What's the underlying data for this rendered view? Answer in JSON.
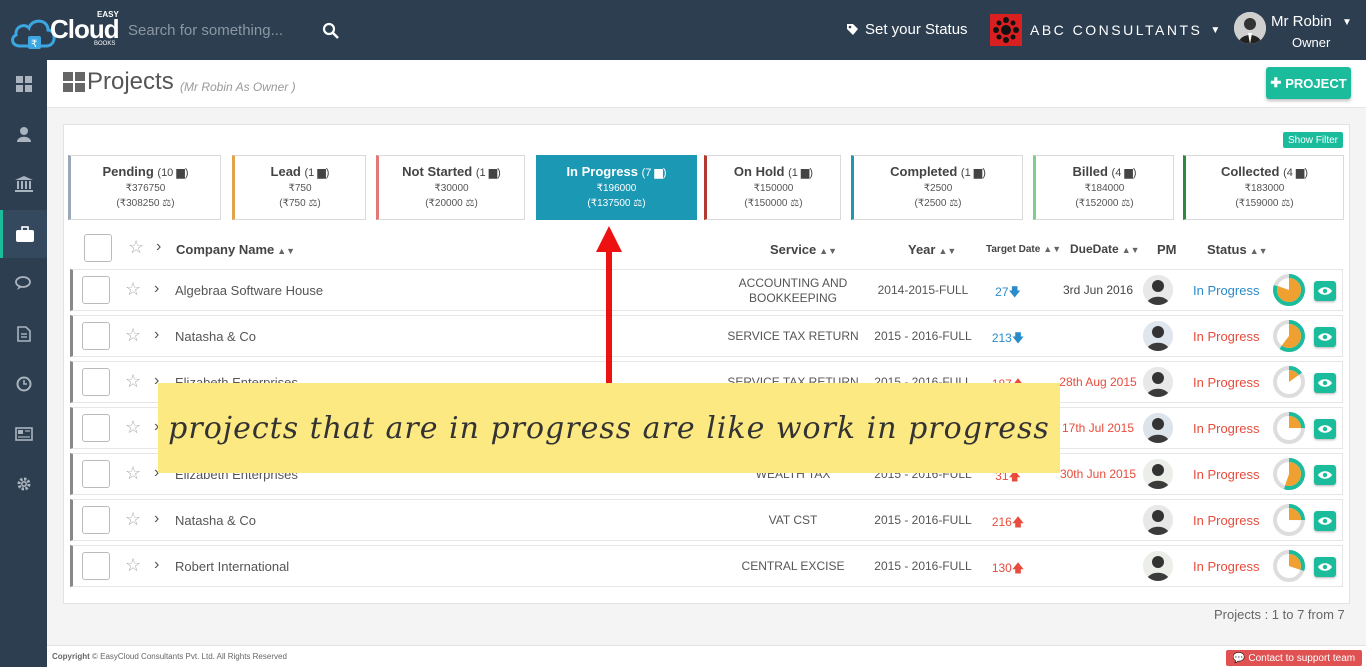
{
  "header": {
    "logo_easy": "EASY",
    "logo_cloud": "Cloud",
    "logo_books": "BOOKS",
    "search_placeholder": "Search for something...",
    "status_label": "Set your Status",
    "company_name": "ABC CONSULTANTS",
    "user_name": "Mr Robin",
    "user_role": "Owner"
  },
  "sidebar": {
    "items": [
      "dashboard-icon",
      "user-icon",
      "bank-icon",
      "briefcase-icon",
      "chat-icon",
      "document-icon",
      "clock-icon",
      "newspaper-icon",
      "gear-icon"
    ],
    "active": "briefcase-icon"
  },
  "page": {
    "title": "Projects",
    "subtitle": "(Mr Robin As Owner )",
    "add_button": "PROJECT",
    "show_filter": "Show Filter"
  },
  "status_tabs": [
    {
      "name": "Pending",
      "count": "(10",
      "amount": "₹376750",
      "sub": "(₹308250",
      "color": "#9aa7b4",
      "active": false
    },
    {
      "name": "Lead",
      "count": "(1",
      "amount": "₹750",
      "sub": "(₹750",
      "color": "#e0a54a",
      "active": false
    },
    {
      "name": "Not Started",
      "count": "(1",
      "amount": "₹30000",
      "sub": "(₹20000",
      "color": "#e07a7a",
      "active": false
    },
    {
      "name": "In Progress",
      "count": "(7",
      "amount": "₹196000",
      "sub": "(₹137500",
      "color": "#1b98b4",
      "active": true
    },
    {
      "name": "On Hold",
      "count": "(1",
      "amount": "₹150000",
      "sub": "(₹150000",
      "color": "#b03a2e",
      "active": false
    },
    {
      "name": "Completed",
      "count": "(1",
      "amount": "₹2500",
      "sub": "(₹2500",
      "color": "#1b98b4",
      "active": false
    },
    {
      "name": "Billed",
      "count": "(4",
      "amount": "₹184000",
      "sub": "(₹152000",
      "color": "#7bd08a",
      "active": false
    },
    {
      "name": "Collected",
      "count": "(4",
      "amount": "₹183000",
      "sub": "(₹159000",
      "color": "#2e8b3e",
      "active": false
    }
  ],
  "table": {
    "headers": {
      "company": "Company Name",
      "service": "Service",
      "year": "Year",
      "target": "Target Date",
      "due": "DueDate",
      "pm": "PM",
      "status": "Status"
    },
    "rows": [
      {
        "company": "Algebraa Software House",
        "service": "ACCOUNTING AND BOOKKEEPING",
        "year": "2014-2015-FULL",
        "target": "27",
        "target_dir": "down",
        "due": "3rd Jun 2016",
        "due_late": false,
        "status": "In Progress",
        "status_color": "blue",
        "progress": 0.8
      },
      {
        "company": "Natasha & Co",
        "service": "SERVICE TAX RETURN",
        "year": "2015 - 2016-FULL",
        "target": "213",
        "target_dir": "down",
        "due": "",
        "due_late": false,
        "status": "In Progress",
        "status_color": "red",
        "progress": 0.6
      },
      {
        "company": "Elizabeth Enterprises",
        "service": "SERVICE TAX RETURN",
        "year": "2015 - 2016-FULL",
        "target": "187",
        "target_dir": "up",
        "due": "28th Aug 2015",
        "due_late": true,
        "status": "In Progress",
        "status_color": "red",
        "progress": 0.15
      },
      {
        "company": "",
        "service": "",
        "year": "",
        "target": "",
        "target_dir": "up",
        "due": "17th Jul 2015",
        "due_late": true,
        "status": "In Progress",
        "status_color": "red",
        "progress": 0.25
      },
      {
        "company": "Elizabeth Enterprises",
        "service": "WEALTH TAX",
        "year": "2015 - 2016-FULL",
        "target": "31",
        "target_dir": "up",
        "due": "30th Jun 2015",
        "due_late": true,
        "status": "In Progress",
        "status_color": "red",
        "progress": 0.55
      },
      {
        "company": "Natasha & Co",
        "service": "VAT CST",
        "year": "2015 - 2016-FULL",
        "target": "216",
        "target_dir": "up",
        "due": "",
        "due_late": false,
        "status": "In Progress",
        "status_color": "red",
        "progress": 0.25
      },
      {
        "company": "Robert International",
        "service": "CENTRAL EXCISE",
        "year": "2015 - 2016-FULL",
        "target": "130",
        "target_dir": "up",
        "due": "",
        "due_late": false,
        "status": "In Progress",
        "status_color": "red",
        "progress": 0.3
      }
    ]
  },
  "paging": "Projects : 1 to 7 from 7",
  "footer": {
    "copyright_bold": "Copyright",
    "copyright": "© EasyCloud Consultants Pvt. Ltd. All Rights Reserved",
    "support": "Contact to support team"
  },
  "annotation": "projects that are in progress are like work in progress"
}
